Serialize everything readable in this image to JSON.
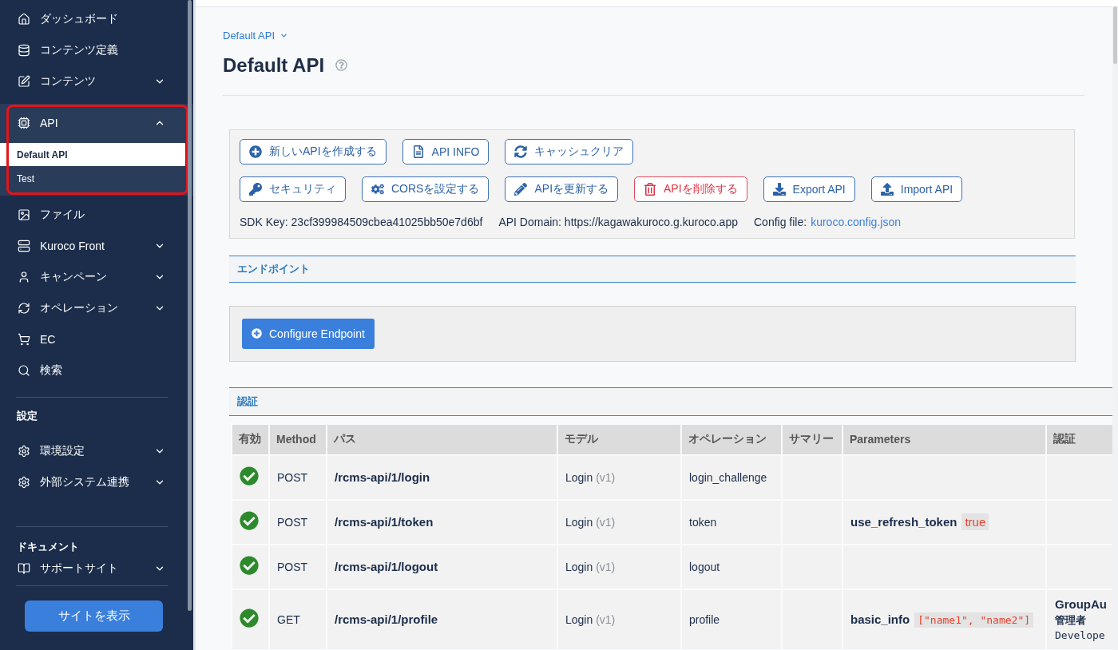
{
  "sidebar": {
    "groups": [
      {
        "items": [
          {
            "label": "ダッシュボード",
            "highlighted": false
          },
          {
            "label": "コンテンツ定義",
            "highlighted": false
          },
          {
            "label": "コンテンツ",
            "expanded": false,
            "highlighted": false
          },
          {
            "label": "API",
            "expanded": true,
            "highlighted": true,
            "children": [
              {
                "label": "Default API",
                "selected": true
              },
              {
                "label": "Test",
                "selected": false
              }
            ]
          },
          {
            "label": "ファイル",
            "highlighted": false
          },
          {
            "label": "Kuroco Front",
            "expanded": false,
            "highlighted": false
          },
          {
            "label": "キャンペーン",
            "expanded": false,
            "highlighted": false
          },
          {
            "label": "オペレーション",
            "expanded": false,
            "highlighted": false
          },
          {
            "label": "EC",
            "highlighted": false
          },
          {
            "label": "検索",
            "highlighted": false
          }
        ]
      },
      {
        "heading": "設定",
        "items": [
          {
            "label": "環境設定",
            "expanded": false,
            "highlighted": false
          },
          {
            "label": "外部システム連携",
            "expanded": false,
            "highlighted": false
          }
        ]
      },
      {
        "heading": "ドキュメント",
        "items": [
          {
            "label": "サポートサイト",
            "expanded": false,
            "highlighted": false
          }
        ]
      }
    ],
    "footer_button": "サイトを表示"
  },
  "breadcrumb": {
    "label": "Default API"
  },
  "page_title": "Default API",
  "api_panel": {
    "button_rows": [
      [
        {
          "label": "新しいAPIを作成する",
          "kind": "default"
        },
        {
          "label": "API INFO",
          "kind": "default"
        },
        {
          "label": "キャッシュクリア",
          "kind": "default"
        }
      ],
      [
        {
          "label": "セキュリティ",
          "kind": "default"
        },
        {
          "label": "CORSを設定する",
          "kind": "default"
        },
        {
          "label": "APIを更新する",
          "kind": "default"
        },
        {
          "label": "APIを削除する",
          "kind": "danger"
        },
        {
          "label": "Export API",
          "kind": "default"
        },
        {
          "label": "Import API",
          "kind": "default"
        }
      ]
    ],
    "sdk_key": "SDK Key: 23cf399984509cbea41025bb50e7d6bf",
    "api_domain": "API Domain: https://kagawakuroco.g.kuroco.app",
    "config_file": {
      "label": "Config file:",
      "link": "kuroco.config.json"
    }
  },
  "endpoint_section": {
    "title": "エンドポイント",
    "button": "Configure Endpoint"
  },
  "auth_section": {
    "title": "認証",
    "table": {
      "columns": [
        "有効",
        "Method",
        "パス",
        "モデル",
        "オペレーション",
        "サマリー",
        "Parameters",
        "認証"
      ],
      "rows": [
        {
          "enabled": true,
          "method": "POST",
          "path": "/rcms-api/1/login",
          "model": "Login",
          "model_version": "(v1)",
          "operation": "login_challenge"
        },
        {
          "enabled": true,
          "method": "POST",
          "path": "/rcms-api/1/token",
          "model": "Login",
          "model_version": "(v1)",
          "operation": "token",
          "parameters": [
            {
              "name": "use_refresh_token",
              "value": "true",
              "kind": "text"
            }
          ]
        },
        {
          "enabled": true,
          "method": "POST",
          "path": "/rcms-api/1/logout",
          "model": "Login",
          "model_version": "(v1)",
          "operation": "logout"
        },
        {
          "enabled": true,
          "method": "GET",
          "path": "/rcms-api/1/profile",
          "model": "Login",
          "model_version": "(v1)",
          "operation": "profile",
          "parameters": [
            {
              "name": "basic_info",
              "value": "[\"name1\", \"name2\"]",
              "kind": "code"
            }
          ],
          "auth": {
            "title": "GroupAu",
            "lines": [
              {
                "text": "管理者",
                "kind": "text"
              },
              {
                "text": "Develope",
                "kind": "code"
              }
            ]
          }
        }
      ]
    }
  }
}
